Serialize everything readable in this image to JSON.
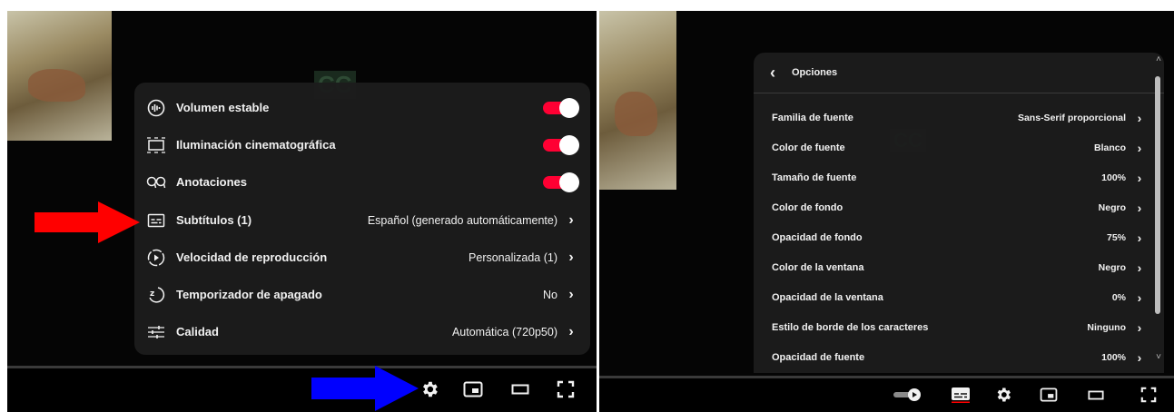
{
  "left_menu": {
    "items": [
      {
        "icon": "stable-volume-icon",
        "label": "Volumen estable",
        "toggle": true
      },
      {
        "icon": "cinematic-lighting-icon",
        "label": "Iluminación cinematográfica",
        "toggle": true
      },
      {
        "icon": "annotations-icon",
        "label": "Anotaciones",
        "toggle": true
      },
      {
        "icon": "subtitles-icon",
        "label": "Subtítulos (1)",
        "value": "Español (generado automáticamente)"
      },
      {
        "icon": "playback-speed-icon",
        "label": "Velocidad de reproducción",
        "value": "Personalizada (1)"
      },
      {
        "icon": "sleep-timer-icon",
        "label": "Temporizador de apagado",
        "value": "No"
      },
      {
        "icon": "quality-icon",
        "label": "Calidad",
        "value": "Automática (720p50)"
      }
    ]
  },
  "right_menu": {
    "header": "Opciones",
    "items": [
      {
        "label": "Familia de fuente",
        "value": "Sans-Serif proporcional"
      },
      {
        "label": "Color de fuente",
        "value": "Blanco"
      },
      {
        "label": "Tamaño de fuente",
        "value": "100%"
      },
      {
        "label": "Color de fondo",
        "value": "Negro"
      },
      {
        "label": "Opacidad de fondo",
        "value": "75%"
      },
      {
        "label": "Color de la ventana",
        "value": "Negro"
      },
      {
        "label": "Opacidad de la ventana",
        "value": "0%"
      },
      {
        "label": "Estilo de borde de los caracteres",
        "value": "Ninguno"
      },
      {
        "label": "Opacidad de fuente",
        "value": "100%"
      }
    ]
  },
  "colors": {
    "toggle_on": "#ff0033",
    "annotation_red": "#ff0000",
    "annotation_blue": "#0000ff"
  }
}
